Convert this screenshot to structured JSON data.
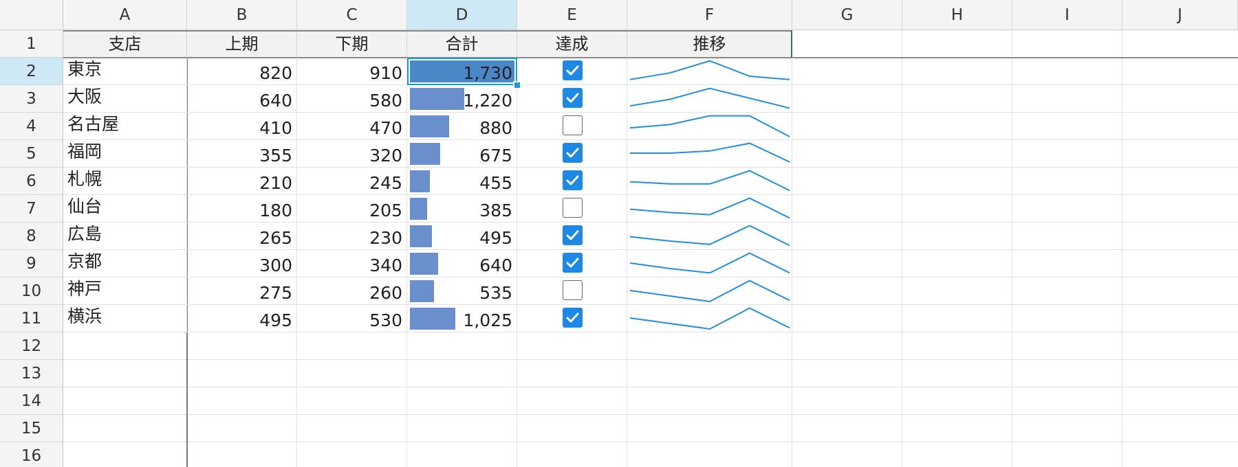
{
  "columns": [
    "A",
    "B",
    "C",
    "D",
    "E",
    "F",
    "G",
    "H",
    "I",
    "J"
  ],
  "selected_column": "D",
  "selected_row": 2,
  "row_numbers": [
    "1",
    "2",
    "3",
    "4",
    "5",
    "6",
    "7",
    "8",
    "9",
    "10",
    "11",
    "12",
    "13",
    "14",
    "15",
    "16"
  ],
  "headers": {
    "branch": "支店",
    "h1": "上期",
    "h2": "下期",
    "total": "合計",
    "achieved": "達成",
    "trend": "推移"
  },
  "rows": [
    {
      "branch": "東京",
      "h1": "820",
      "h2": "910",
      "total": "1,730",
      "total_value": 1730,
      "achieved": true,
      "trend": [
        0.1,
        0.4,
        0.95,
        0.25,
        0.1
      ]
    },
    {
      "branch": "大阪",
      "h1": "640",
      "h2": "580",
      "total": "1,220",
      "total_value": 1220,
      "achieved": true,
      "trend": [
        0.15,
        0.45,
        0.95,
        0.5,
        0.05
      ]
    },
    {
      "branch": "名古屋",
      "h1": "410",
      "h2": "470",
      "total": "880",
      "total_value": 880,
      "achieved": false,
      "trend": [
        0.4,
        0.55,
        0.95,
        0.95,
        0.0
      ]
    },
    {
      "branch": "福岡",
      "h1": "355",
      "h2": "320",
      "total": "675",
      "total_value": 675,
      "achieved": true,
      "trend": [
        0.5,
        0.5,
        0.6,
        0.95,
        0.1
      ]
    },
    {
      "branch": "札幌",
      "h1": "210",
      "h2": "245",
      "total": "455",
      "total_value": 455,
      "achieved": true,
      "trend": [
        0.45,
        0.35,
        0.35,
        0.95,
        0.05
      ]
    },
    {
      "branch": "仙台",
      "h1": "180",
      "h2": "205",
      "total": "385",
      "total_value": 385,
      "achieved": false,
      "trend": [
        0.45,
        0.3,
        0.2,
        0.95,
        0.05
      ]
    },
    {
      "branch": "広島",
      "h1": "265",
      "h2": "230",
      "total": "495",
      "total_value": 495,
      "achieved": true,
      "trend": [
        0.45,
        0.25,
        0.1,
        0.95,
        0.05
      ]
    },
    {
      "branch": "京都",
      "h1": "300",
      "h2": "340",
      "total": "640",
      "total_value": 640,
      "achieved": true,
      "trend": [
        0.5,
        0.25,
        0.05,
        0.95,
        0.05
      ]
    },
    {
      "branch": "神戸",
      "h1": "275",
      "h2": "260",
      "total": "535",
      "total_value": 535,
      "achieved": false,
      "trend": [
        0.5,
        0.25,
        0.0,
        0.95,
        0.05
      ]
    },
    {
      "branch": "横浜",
      "h1": "495",
      "h2": "530",
      "total": "1,025",
      "total_value": 1025,
      "achieved": true,
      "trend": [
        0.5,
        0.25,
        0.0,
        0.95,
        0.05
      ]
    }
  ],
  "colors": {
    "data_bar": "#6990cc",
    "data_bar_selected": "#4a87c6",
    "checkbox": "#1e88e5",
    "sparkline": "#1e8ee6",
    "selection": "#1aa0c8",
    "header_border": "#2e7d4f"
  }
}
